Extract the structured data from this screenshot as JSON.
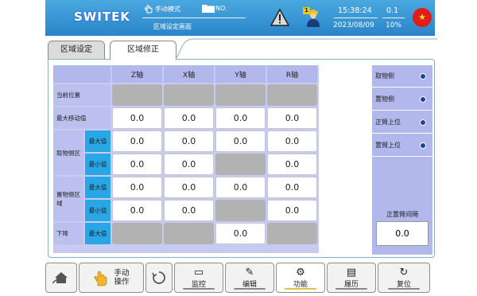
{
  "header": {
    "logo": "SWITEK",
    "mode_label": "手动模式",
    "file_label": "NO.",
    "screen_name": "区域设定画面",
    "worker_badge": "1",
    "time": "15:38:24",
    "date": "2023/08/09",
    "speed": "0.1",
    "percent": "10%",
    "flag_icon": "china-flag-icon"
  },
  "tabs": [
    {
      "label": "区域设定",
      "active": false
    },
    {
      "label": "区域修正",
      "active": true
    }
  ],
  "grid": {
    "columns": [
      "Z轴",
      "X轴",
      "Y轴",
      "R轴"
    ],
    "rows": {
      "current_position": "当前位置",
      "max_move": "最大移动值",
      "pick_zone": "取物侧区",
      "place_zone": "置物侧区域",
      "descend": "下降",
      "max_value": "最大值",
      "min_value": "最小值"
    },
    "values": {
      "max_move": [
        "0.0",
        "0.0",
        "0.0",
        "0.0"
      ],
      "pick_max": [
        "0.0",
        "0.0",
        "0.0",
        "0.0"
      ],
      "pick_min": [
        "0.0",
        "0.0",
        "",
        "0.0"
      ],
      "place_max": [
        "0.0",
        "0.0",
        "0.0",
        "0.0"
      ],
      "place_min": [
        "0.0",
        "0.0",
        "",
        "0.0"
      ],
      "descend_max": [
        "",
        "",
        "0.0",
        ""
      ]
    }
  },
  "side_panel": {
    "items": [
      "取物侧",
      "置物侧",
      "正臂上位",
      "置臂上位"
    ],
    "interval_label": "正置臂间隔",
    "interval_value": "0.0"
  },
  "bottom": {
    "manual_op": "手动\n操作",
    "monitor": "监控",
    "edit": "编辑",
    "function": "功能",
    "history": "履历",
    "reset": "复位"
  },
  "colors": {
    "header_bg": "#2a84c8",
    "grid_header": "#b3b8ec",
    "sub_label": "#29a6e6",
    "inactive_cell": "#b2b2b2",
    "accent_underline": "#e0c24a"
  }
}
